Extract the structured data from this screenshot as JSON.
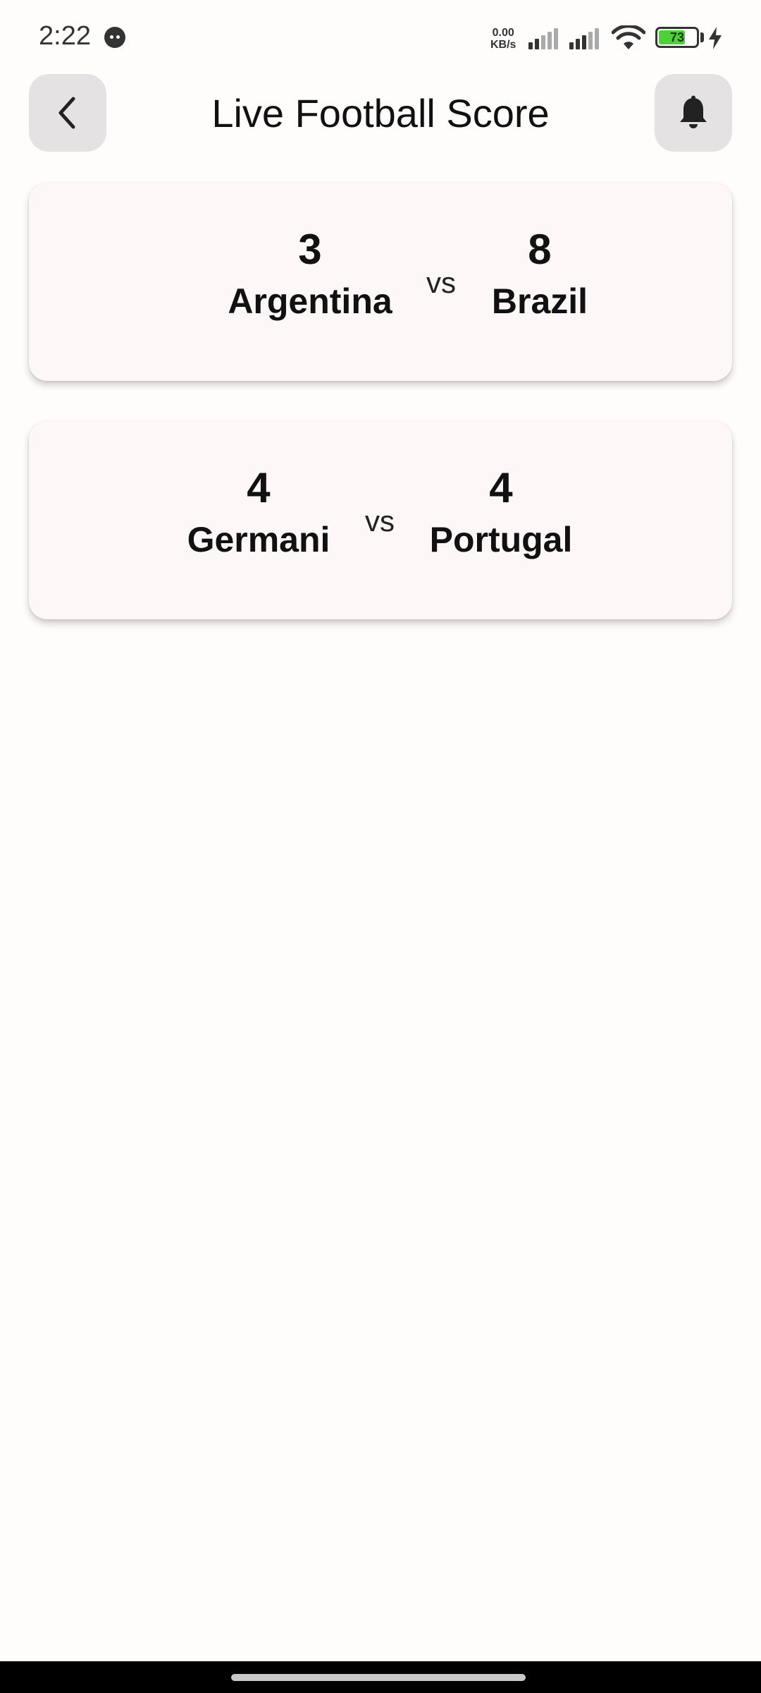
{
  "status_bar": {
    "time": "2:22",
    "net_speed_value": "0.00",
    "net_speed_unit": "KB/s",
    "battery_level": "73",
    "battery_fraction": 0.73
  },
  "app_bar": {
    "title": "Live Football Score",
    "back_icon": "chevron-left-icon",
    "notification_icon": "bell-icon"
  },
  "matches": [
    {
      "home_team": "Argentina",
      "home_score": "3",
      "separator": "vs",
      "away_team": "Brazil",
      "away_score": "8"
    },
    {
      "home_team": "Germani",
      "home_score": "4",
      "separator": "vs",
      "away_team": "Portugal",
      "away_score": "4"
    }
  ],
  "colors": {
    "background": "#fffcfc",
    "card": "#fdf8f7",
    "icon_button": "#e4e2e2",
    "battery": "#4cd137"
  }
}
